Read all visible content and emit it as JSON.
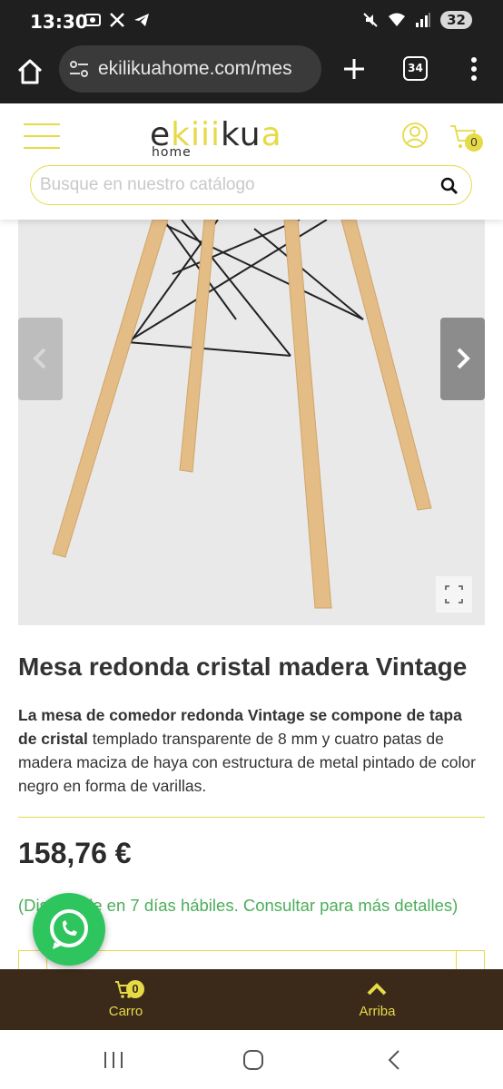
{
  "status_bar": {
    "time": "13:30",
    "battery": "32",
    "left_icons": [
      "screenshot-icon",
      "x-icon",
      "telegram-icon"
    ],
    "right_icons": [
      "mute-icon",
      "wifi-icon",
      "signal-icon"
    ]
  },
  "browser": {
    "url": "ekilikuahome.com/mes",
    "tab_count": "34"
  },
  "header": {
    "logo_main_dark_1": "e",
    "logo_main_yellow_1": "kiii",
    "logo_main_dark_2": "ku",
    "logo_main_yellow_2": "a",
    "logo_sub": "home",
    "cart_count": "0",
    "search_placeholder": "Busque en nuestro catálogo"
  },
  "product": {
    "title": "Mesa redonda cristal madera Vintage",
    "desc_bold": "La mesa de comedor redonda Vintage se compone de tapa de cristal",
    "desc_rest": " templado transparente de 8 mm y cuatro patas de madera maciza de haya con estructura de metal pintado de color negro en forma de varillas.",
    "price": "158,76 €",
    "availability": "(Disponible en 7 días hábiles. Consultar para más detalles)"
  },
  "bottom_bar": {
    "cart_label": "Carro",
    "cart_count": "0",
    "top_label": "Arriba"
  },
  "colors": {
    "accent": "#e6da47",
    "availability": "#4cae5a",
    "bottom_bar": "#3b2a1a",
    "whatsapp": "#2fc55e"
  }
}
